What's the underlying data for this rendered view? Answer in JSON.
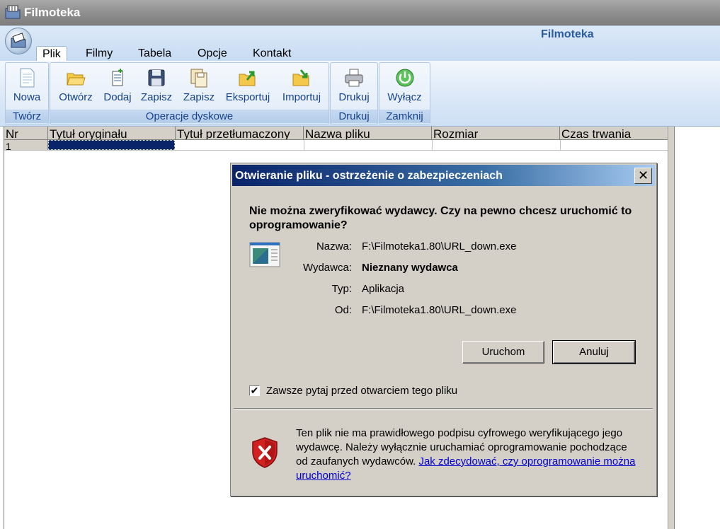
{
  "window": {
    "title": "Filmoteka"
  },
  "ribbon": {
    "title": "Filmoteka",
    "tabs": [
      "Plik",
      "Filmy",
      "Tabela",
      "Opcje",
      "Kontakt"
    ],
    "groups": {
      "tworz": {
        "title": "Twórz",
        "buttons": [
          "Nowa"
        ]
      },
      "operacje": {
        "title": "Operacje dyskowe",
        "buttons": [
          "Otwórz",
          "Dodaj",
          "Zapisz",
          "Zapisz",
          "Eksportuj",
          "Importuj"
        ]
      },
      "drukuj": {
        "title": "Drukuj",
        "buttons": [
          "Drukuj"
        ]
      },
      "zamknij": {
        "title": "Zamknij",
        "buttons": [
          "Wyłącz"
        ]
      }
    }
  },
  "grid": {
    "columns": [
      "Nr",
      "Tytuł oryginału",
      "Tytuł przetłumaczony",
      "Nazwa pliku",
      "Rozmiar",
      "Czas trwania"
    ],
    "rows": [
      {
        "nr": "1"
      }
    ]
  },
  "dialog": {
    "title": "Otwieranie pliku - ostrzeżenie o zabezpieczeniach",
    "question": "Nie można zweryfikować wydawcy. Czy na pewno chcesz uruchomić to oprogramowanie?",
    "fields": [
      {
        "label": "Nazwa:",
        "value": "F:\\Filmoteka1.80\\URL_down.exe"
      },
      {
        "label": "Wydawca:",
        "value": "Nieznany wydawca"
      },
      {
        "label": "Typ:",
        "value": "Aplikacja"
      },
      {
        "label": "Od:",
        "value": "F:\\Filmoteka1.80\\URL_down.exe"
      }
    ],
    "run_label": "Uruchom",
    "cancel_label": "Anuluj",
    "checkbox_label": "Zawsze pytaj przed otwarciem tego pliku",
    "checkbox_checked": true,
    "warning_text": "Ten plik nie ma prawidłowego podpisu cyfrowego weryfikującego jego wydawcę. Należy wyłącznie uruchamiać oprogramowanie pochodzące od zaufanych wydawców.",
    "link_text": "Jak zdecydować, czy oprogramowanie można uruchomić?",
    "close_glyph": "✕",
    "check_glyph": "✔"
  },
  "icons": {
    "app": "film-folder-icon",
    "new": "new-document-icon",
    "open": "folder-open-icon",
    "add": "add-document-icon",
    "save": "floppy-disk-icon",
    "save_as": "save-as-icon",
    "export": "folder-export-icon",
    "import": "folder-import-icon",
    "print": "printer-icon",
    "power": "power-icon",
    "exe": "application-icon",
    "shield": "security-shield-error-icon"
  },
  "colors": {
    "ribbon_text": "#15428b",
    "dialog_title_start": "#0a246a",
    "link": "#0000cc",
    "shield_red": "#d22020"
  }
}
